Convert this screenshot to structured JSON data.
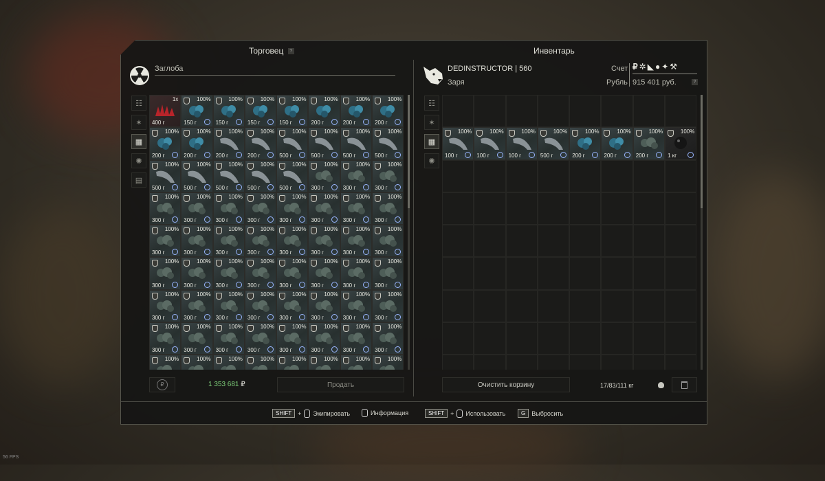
{
  "fps": "56 FPS",
  "trader": {
    "title": "Торговец",
    "help": "?",
    "name": "Заглоба",
    "sum": "1 353 681",
    "sum_currency": "₽",
    "sell_label": "Продать",
    "tabs": [
      "list-icon",
      "star-icon",
      "grid-icon",
      "gear-icon",
      "box-icon"
    ],
    "active_tab": 2,
    "rows": [
      [
        {
          "w": "400 г",
          "q": "1x",
          "c": "red"
        },
        {
          "w": "150 г",
          "p": "100%",
          "c": "blue"
        },
        {
          "w": "150 г",
          "p": "100%",
          "c": "blue"
        },
        {
          "w": "150 г",
          "p": "100%",
          "c": "blue"
        },
        {
          "w": "150 г",
          "p": "100%",
          "c": "blue"
        },
        {
          "w": "200 г",
          "p": "100%",
          "c": "blue"
        },
        {
          "w": "200 г",
          "p": "100%",
          "c": "blue"
        },
        {
          "w": "200 г",
          "p": "100%",
          "c": "blue"
        }
      ],
      [
        {
          "w": "200 г",
          "p": "100%",
          "c": "blue"
        },
        {
          "w": "200 г",
          "p": "100%",
          "c": "blue"
        },
        {
          "w": "200 г",
          "p": "100%",
          "c": "grey"
        },
        {
          "w": "200 г",
          "p": "100%",
          "c": "grey"
        },
        {
          "w": "500 г",
          "p": "100%",
          "c": "grey"
        },
        {
          "w": "500 г",
          "p": "100%",
          "c": "grey"
        },
        {
          "w": "500 г",
          "p": "100%",
          "c": "grey"
        },
        {
          "w": "500 г",
          "p": "100%",
          "c": "grey"
        }
      ],
      [
        {
          "w": "500 г",
          "p": "100%",
          "c": "grey"
        },
        {
          "w": "500 г",
          "p": "100%",
          "c": "grey"
        },
        {
          "w": "500 г",
          "p": "100%",
          "c": "grey"
        },
        {
          "w": "500 г",
          "p": "100%",
          "c": "grey"
        },
        {
          "w": "500 г",
          "p": "100%",
          "c": "grey"
        },
        {
          "w": "300 г",
          "p": "100%",
          "c": "moss"
        },
        {
          "w": "300 г",
          "p": "100%",
          "c": "moss"
        },
        {
          "w": "300 г",
          "p": "100%",
          "c": "moss"
        }
      ],
      [
        {
          "w": "300 г",
          "p": "100%",
          "c": "moss"
        },
        {
          "w": "300 г",
          "p": "100%",
          "c": "moss"
        },
        {
          "w": "300 г",
          "p": "100%",
          "c": "moss"
        },
        {
          "w": "300 г",
          "p": "100%",
          "c": "moss"
        },
        {
          "w": "300 г",
          "p": "100%",
          "c": "moss"
        },
        {
          "w": "300 г",
          "p": "100%",
          "c": "moss"
        },
        {
          "w": "300 г",
          "p": "100%",
          "c": "moss"
        },
        {
          "w": "300 г",
          "p": "100%",
          "c": "moss"
        }
      ],
      [
        {
          "w": "300 г",
          "p": "100%",
          "c": "moss"
        },
        {
          "w": "300 г",
          "p": "100%",
          "c": "moss"
        },
        {
          "w": "300 г",
          "p": "100%",
          "c": "moss"
        },
        {
          "w": "300 г",
          "p": "100%",
          "c": "moss"
        },
        {
          "w": "300 г",
          "p": "100%",
          "c": "moss"
        },
        {
          "w": "300 г",
          "p": "100%",
          "c": "moss"
        },
        {
          "w": "300 г",
          "p": "100%",
          "c": "moss"
        },
        {
          "w": "300 г",
          "p": "100%",
          "c": "moss"
        }
      ],
      [
        {
          "w": "300 г",
          "p": "100%",
          "c": "moss"
        },
        {
          "w": "300 г",
          "p": "100%",
          "c": "moss"
        },
        {
          "w": "300 г",
          "p": "100%",
          "c": "moss"
        },
        {
          "w": "300 г",
          "p": "100%",
          "c": "moss"
        },
        {
          "w": "300 г",
          "p": "100%",
          "c": "moss"
        },
        {
          "w": "300 г",
          "p": "100%",
          "c": "moss"
        },
        {
          "w": "300 г",
          "p": "100%",
          "c": "moss"
        },
        {
          "w": "300 г",
          "p": "100%",
          "c": "moss"
        }
      ],
      [
        {
          "w": "300 г",
          "p": "100%",
          "c": "moss"
        },
        {
          "w": "300 г",
          "p": "100%",
          "c": "moss"
        },
        {
          "w": "300 г",
          "p": "100%",
          "c": "moss"
        },
        {
          "w": "300 г",
          "p": "100%",
          "c": "moss"
        },
        {
          "w": "300 г",
          "p": "100%",
          "c": "moss"
        },
        {
          "w": "300 г",
          "p": "100%",
          "c": "moss"
        },
        {
          "w": "300 г",
          "p": "100%",
          "c": "moss"
        },
        {
          "w": "300 г",
          "p": "100%",
          "c": "moss"
        }
      ],
      [
        {
          "w": "300 г",
          "p": "100%",
          "c": "moss"
        },
        {
          "w": "300 г",
          "p": "100%",
          "c": "moss"
        },
        {
          "w": "300 г",
          "p": "100%",
          "c": "moss"
        },
        {
          "w": "300 г",
          "p": "100%",
          "c": "moss"
        },
        {
          "w": "300 г",
          "p": "100%",
          "c": "moss"
        },
        {
          "w": "300 г",
          "p": "100%",
          "c": "moss"
        },
        {
          "w": "300 г",
          "p": "100%",
          "c": "moss"
        },
        {
          "w": "300 г",
          "p": "100%",
          "c": "moss"
        }
      ],
      [
        {
          "w": "",
          "p": "100%",
          "c": "moss"
        },
        {
          "w": "",
          "p": "100%",
          "c": "moss"
        },
        {
          "w": "",
          "p": "100%",
          "c": "moss"
        },
        {
          "w": "",
          "p": "100%",
          "c": "moss"
        },
        {
          "w": "",
          "p": "100%",
          "c": "moss"
        },
        {
          "w": "",
          "p": "100%",
          "c": "moss"
        },
        {
          "w": "",
          "p": "100%",
          "c": "moss"
        },
        {
          "w": "",
          "p": "100%",
          "c": "moss"
        }
      ]
    ]
  },
  "inventory": {
    "title": "Инвентарь",
    "player": "DEDINSTRUCTOR | 560",
    "faction": "Заря",
    "account_label": "Счет",
    "currency_label": "Рубль",
    "balance": "915 401 руб.",
    "help": "?",
    "clear_label": "Очистить корзину",
    "weight": "17/83/111 кг",
    "tabs": [
      "list-icon",
      "star-icon",
      "grid-icon",
      "gear-icon"
    ],
    "active_tab": 2,
    "items": [
      {
        "w": "100 г",
        "p": "100%",
        "c": "grey"
      },
      {
        "w": "100 г",
        "p": "100%",
        "c": "grey"
      },
      {
        "w": "100 г",
        "p": "100%",
        "c": "grey"
      },
      {
        "w": "500 г",
        "p": "100%",
        "c": "grey"
      },
      {
        "w": "200 г",
        "p": "100%",
        "c": "blue"
      },
      {
        "w": "200 г",
        "p": "100%",
        "c": "blue"
      },
      {
        "w": "200 г",
        "p": "100%",
        "c": "moss"
      },
      {
        "w": "1 кг",
        "p": "100%",
        "c": "dark"
      }
    ]
  },
  "hints": [
    {
      "key": "SHIFT",
      "label": "Экипировать",
      "mouse": true
    },
    {
      "key": "",
      "label": "Информация",
      "mouse": true
    },
    {
      "key": "SHIFT",
      "label": "Использовать",
      "mouse": true
    },
    {
      "key": "G",
      "label": "Выбросить",
      "mouse": false
    }
  ],
  "colors": {
    "sum_green": "#7fd07a",
    "clock_blue": "#9ab6ff"
  }
}
